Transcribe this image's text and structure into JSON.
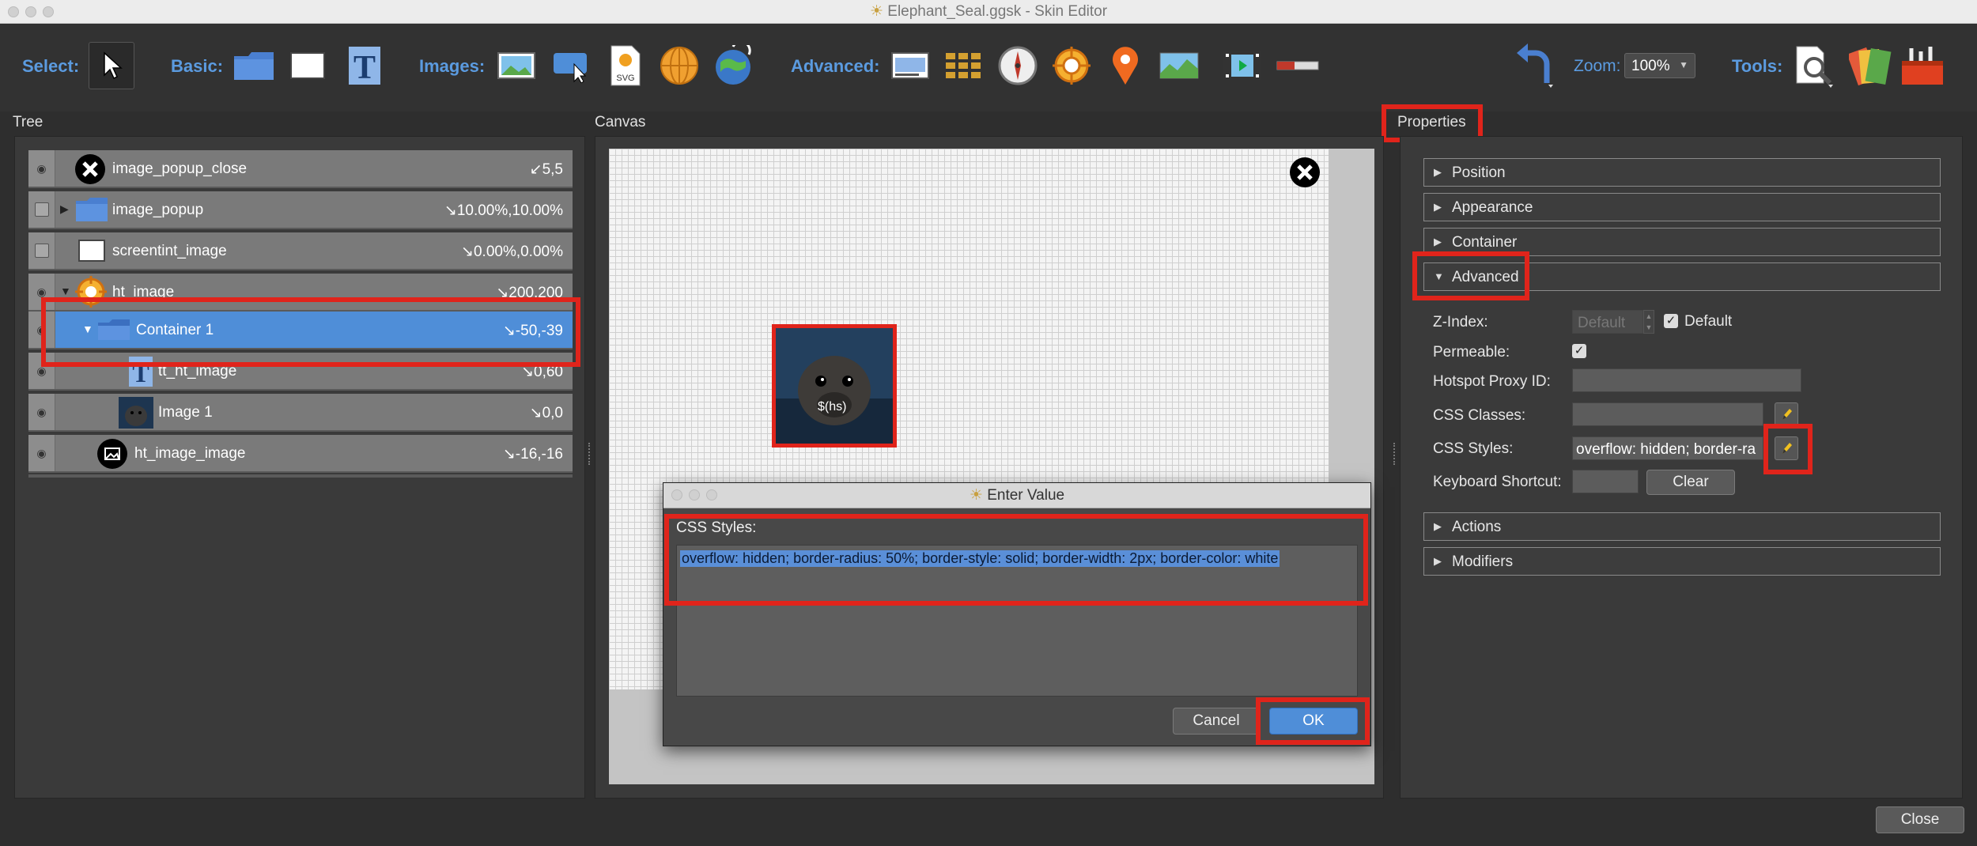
{
  "window": {
    "title": "Elephant_Seal.ggsk - Skin Editor"
  },
  "toolbar": {
    "select_label": "Select:",
    "basic_label": "Basic:",
    "images_label": "Images:",
    "advanced_label": "Advanced:",
    "zoom_label": "Zoom:",
    "zoom_value": "100%",
    "tools_label": "Tools:",
    "svg_icon_text": "SVG"
  },
  "panels": {
    "tree_title": "Tree",
    "canvas_title": "Canvas",
    "properties_title": "Properties"
  },
  "tree": {
    "rows": [
      {
        "name": "image_popup_close",
        "value": "↙5,5"
      },
      {
        "name": "image_popup",
        "value": "↘10.00%,10.00%"
      },
      {
        "name": "screentint_image",
        "value": "↘0.00%,0.00%"
      },
      {
        "name": "ht_image",
        "value": "↘200,200"
      },
      {
        "name": "Container 1",
        "value": "↘-50,-39"
      },
      {
        "name": "tt_ht_image",
        "value": "↘0,60"
      },
      {
        "name": "Image 1",
        "value": "↘0,0"
      },
      {
        "name": "ht_image_image",
        "value": "↘-16,-16"
      }
    ]
  },
  "canvas": {
    "hotspot_text": "$(hs)"
  },
  "properties": {
    "sections": {
      "position": "Position",
      "appearance": "Appearance",
      "container": "Container",
      "advanced": "Advanced",
      "actions": "Actions",
      "modifiers": "Modifiers"
    },
    "zindex_label": "Z-Index:",
    "zindex_placeholder": "Default",
    "default_checkbox_label": "Default",
    "permeable_label": "Permeable:",
    "proxy_label": "Hotspot Proxy ID:",
    "css_classes_label": "CSS Classes:",
    "css_styles_label": "CSS Styles:",
    "css_styles_value": "overflow: hidden; border-ra",
    "shortcut_label": "Keyboard Shortcut:",
    "clear_label": "Clear"
  },
  "dialog": {
    "title": "Enter Value",
    "field_label": "CSS Styles:",
    "value": "overflow: hidden; border-radius: 50%; border-style: solid; border-width: 2px; border-color: white",
    "cancel_label": "Cancel",
    "ok_label": "OK"
  },
  "footer": {
    "close_label": "Close"
  },
  "colors": {
    "highlight": "#e0241b",
    "selection": "#4f8ed8",
    "accent_label": "#5b9be0"
  }
}
